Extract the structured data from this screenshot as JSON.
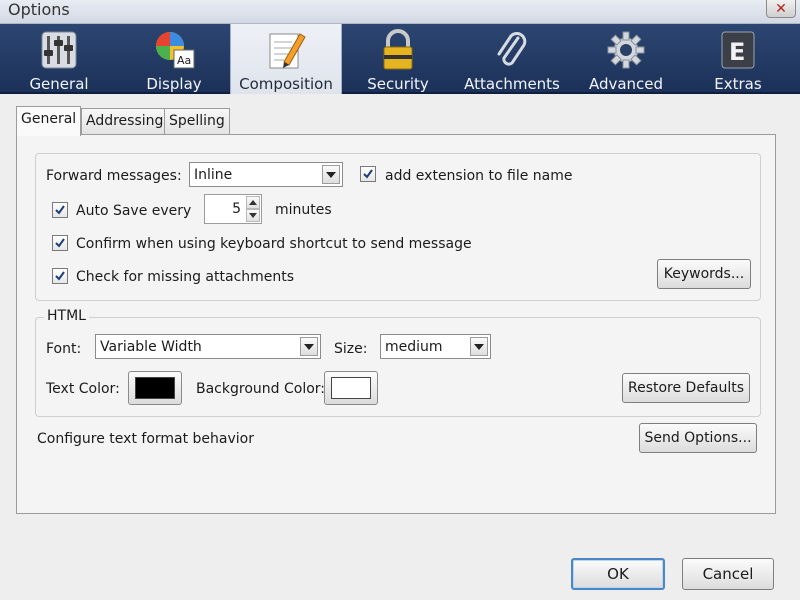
{
  "window": {
    "title": "Options"
  },
  "panes": [
    {
      "label": "General",
      "icon": "sliders-icon"
    },
    {
      "label": "Display",
      "icon": "palette-font-icon"
    },
    {
      "label": "Composition",
      "icon": "pencil-document-icon",
      "active": true
    },
    {
      "label": "Security",
      "icon": "padlock-icon"
    },
    {
      "label": "Attachments",
      "icon": "paperclip-icon"
    },
    {
      "label": "Advanced",
      "icon": "gear-icon"
    },
    {
      "label": "Extras",
      "icon": "extras-e-icon"
    }
  ],
  "subtabs": [
    {
      "label": "General",
      "active": true
    },
    {
      "label": "Addressing"
    },
    {
      "label": "Spelling"
    }
  ],
  "general": {
    "forward_label": "Forward messages:",
    "forward_value": "Inline",
    "add_extension_label": "add extension to file name",
    "add_extension_checked": true,
    "autosave_label": "Auto Save every",
    "autosave_checked": true,
    "autosave_minutes": "5",
    "minutes_label": "minutes",
    "confirm_label": "Confirm when using keyboard shortcut to send message",
    "confirm_checked": true,
    "missing_attach_label": "Check for missing attachments",
    "missing_attach_checked": true,
    "keywords_button": "Keywords..."
  },
  "html": {
    "legend": "HTML",
    "font_label": "Font:",
    "font_value": "Variable Width",
    "size_label": "Size:",
    "size_value": "medium",
    "text_color_label": "Text Color:",
    "text_color": "#000000",
    "bg_color_label": "Background Color:",
    "bg_color": "#ffffff",
    "restore_button": "Restore Defaults"
  },
  "format": {
    "label": "Configure text format behavior",
    "send_options_button": "Send Options..."
  },
  "footer": {
    "ok_label": "OK",
    "cancel_label": "Cancel"
  },
  "colors": {
    "toolbar_bg": "#22395f",
    "default_button_border": "#4c86c6"
  }
}
